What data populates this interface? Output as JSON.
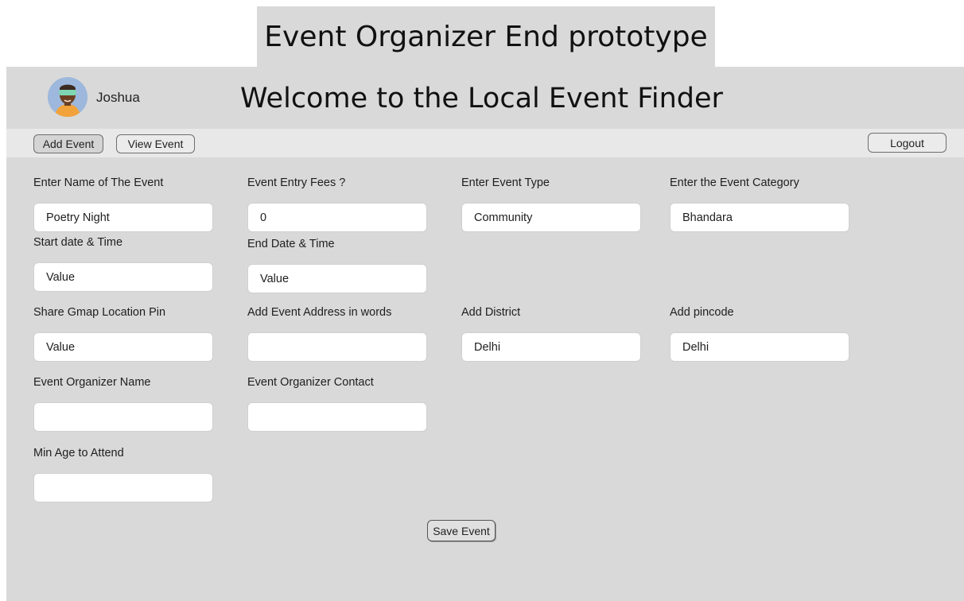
{
  "prototype_title": "Event Organizer End prototype",
  "header": {
    "username": "Joshua",
    "welcome_title": "Welcome to the Local Event Finder"
  },
  "navbar": {
    "add_event": "Add Event",
    "view_event": "View Event",
    "logout": "Logout"
  },
  "form": {
    "event_name": {
      "label": "Enter Name of The Event",
      "value": "Poetry Night"
    },
    "entry_fees": {
      "label": "Event Entry Fees ?",
      "value": "0"
    },
    "event_type": {
      "label": "Enter Event Type",
      "value": "Community"
    },
    "event_category": {
      "label": "Enter the Event Category",
      "value": "Bhandara"
    },
    "start_datetime": {
      "label": "Start date & Time",
      "value": "Value"
    },
    "end_datetime": {
      "label": "End Date & Time",
      "value": "Value"
    },
    "gmap_pin": {
      "label": "Share Gmap Location Pin",
      "value": "Value"
    },
    "address_words": {
      "label": "Add Event Address in words",
      "value": ""
    },
    "district": {
      "label": "Add District",
      "value": "Delhi"
    },
    "pincode": {
      "label": "Add pincode",
      "value": "Delhi"
    },
    "organizer_name": {
      "label": "Event Organizer Name",
      "value": ""
    },
    "organizer_contact": {
      "label": "Event Organizer Contact",
      "value": ""
    },
    "min_age": {
      "label": "Min Age to Attend",
      "value": ""
    },
    "save_button": "Save Event"
  },
  "colors": {
    "frame_background": "#d9d9d9",
    "navbar_background": "#e8e8e8",
    "input_background": "#ffffff"
  }
}
